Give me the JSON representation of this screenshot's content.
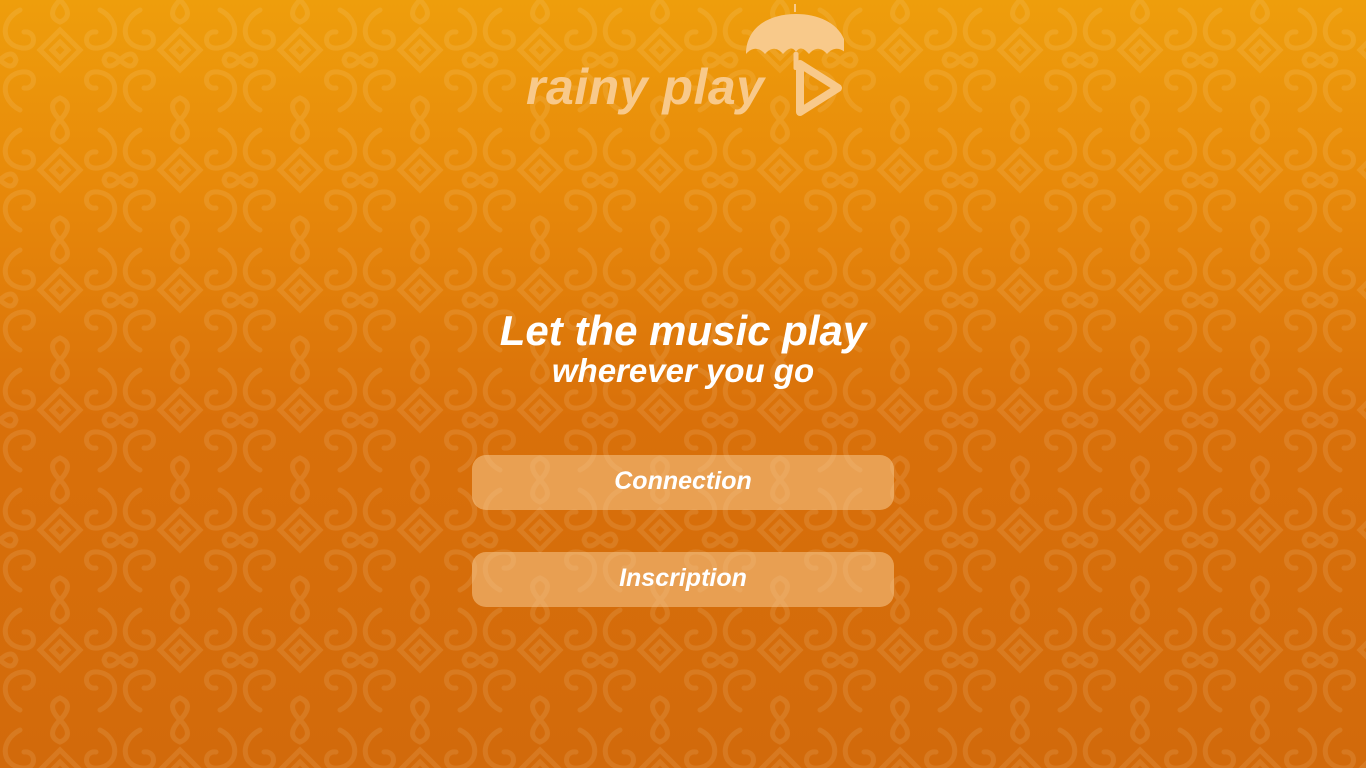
{
  "brand": {
    "name": "rainy play",
    "logo_icon": "umbrella-play-icon",
    "logo_color": "#f8c98a"
  },
  "hero": {
    "title": "Let the music play",
    "subtitle": "wherever you go"
  },
  "actions": {
    "connection_label": "Connection",
    "inscription_label": "Inscription"
  },
  "theme": {
    "background_top": "#ee9e0c",
    "background_bottom": "#d26a0b",
    "button_fill": "rgba(250, 205, 150, 0.52)",
    "text_color": "#ffffff"
  }
}
